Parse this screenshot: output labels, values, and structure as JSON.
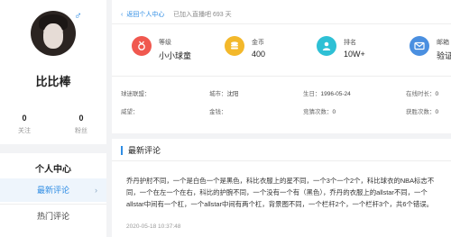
{
  "profile": {
    "gender_symbol": "♂",
    "username": "比比棒",
    "follow_count": "0",
    "follow_label": "关注",
    "fans_count": "0",
    "fans_label": "粉丝"
  },
  "menu": {
    "title": "个人中心",
    "items": [
      {
        "label": "最新评论",
        "active": true,
        "arrow": "›"
      },
      {
        "label": "热门评论",
        "active": false
      }
    ]
  },
  "header": {
    "back_label": "返回个人中心",
    "back_arrow": "‹",
    "joined_text": "已加入直播吧 693 天"
  },
  "metrics": [
    {
      "label": "等级",
      "value": "小小球童",
      "icon": "medal-icon",
      "color": "#f0584f"
    },
    {
      "label": "金币",
      "value": "400",
      "icon": "coin-stack-icon",
      "color": "#f3b82b"
    },
    {
      "label": "排名",
      "value": "10W+",
      "icon": "user-rank-icon",
      "color": "#2ec0d5"
    },
    {
      "label": "邮箱",
      "value": "验证",
      "icon": "mail-icon",
      "color": "#4a8fe0"
    }
  ],
  "info": {
    "league_label": "球迷联盟：",
    "league_value": "",
    "city_label": "城市：",
    "city_value": "沈阳",
    "birthday_label": "生日：",
    "birthday_value": "1996-05-24",
    "online_label": "在线时长：",
    "online_value": "0",
    "prestige_label": "威望：",
    "prestige_value": "",
    "gold_label": "金钱：",
    "gold_value": "",
    "guess_label": "竞猜次数：",
    "guess_value": "0",
    "win_label": "获胜次数：",
    "win_value": "0"
  },
  "comments": {
    "title": "最新评论",
    "latest": {
      "text": "乔丹护肘不同，一个是白色一个是黑色，科比衣服上的星不同，一个3个一个2个，科比球衣的NBA标志不同，一个在左一个在右，科比的护腕不同，一个没有一个有（黑色），乔丹的衣服上的allstar不同，一个allstar中间有一个杠，一个allstar中间有两个杠，背景图不同，一个栏杆2个，一个栏杆3个，共6个错误。",
      "time": "2020-05-18 10:37:48"
    }
  }
}
